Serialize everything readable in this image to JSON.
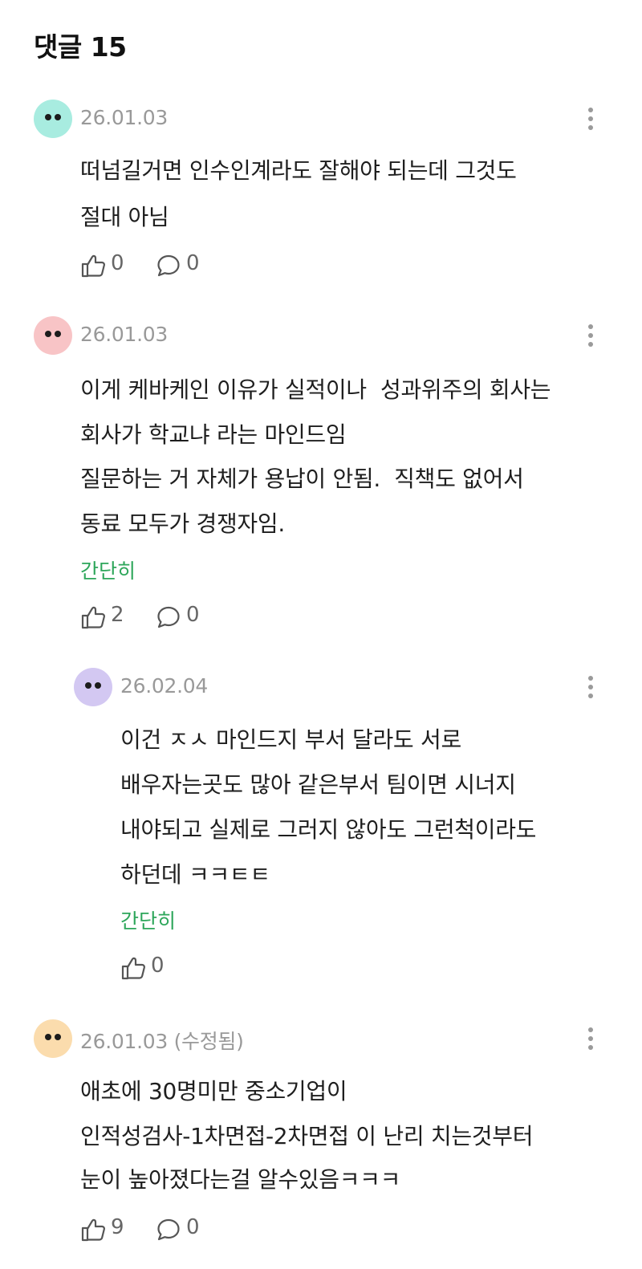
{
  "header": {
    "title": "댓글 15"
  },
  "comments": [
    {
      "date": "26.01.03",
      "avatar_color": "#a8ece0",
      "lines": [
        "떠넘길거면 인수인계라도 잘해야 되는데 그것도",
        "절대 아님"
      ],
      "likes": "0",
      "replies": "0"
    },
    {
      "date": "26.01.03",
      "avatar_color": "#f8c4c6",
      "lines": [
        "이게 케바케인 이유가 실적이나  성과위주의 회사는",
        "회사가 학교냐 라는 마인드임",
        "질문하는 거 자체가 용납이 안됨.  직책도 없어서",
        "동료 모두가 경쟁자임."
      ],
      "collapse_label": "간단히",
      "likes": "2",
      "replies": "0"
    },
    {
      "date": "26.02.04",
      "avatar_color": "#d3c8f2",
      "lines": [
        "이건 ㅈㅅ 마인드지 부서 달라도 서로",
        "배우자는곳도 많아 같은부서 팀이면 시너지",
        "내야되고 실제로 그러지 않아도 그런척이라도",
        "하던데 ㅋㅋㅌㅌ"
      ],
      "collapse_label": "간단히",
      "likes": "0"
    },
    {
      "date": "26.01.03 (수정됨)",
      "avatar_color": "#fbdcad",
      "lines": [
        "애초에 30명미만 중소기업이",
        "인적성검사-1차면접-2차면접 이 난리 치는것부터",
        "눈이 높아졌다는걸 알수있음ㅋㅋㅋ"
      ],
      "likes": "9",
      "replies": "0"
    }
  ],
  "icons": {
    "like": "thumbs-up-icon",
    "reply": "speech-bubble-icon",
    "more": "more-vertical-icon"
  },
  "colors": {
    "accent_green": "#2da65a",
    "meta_gray": "#999999"
  }
}
